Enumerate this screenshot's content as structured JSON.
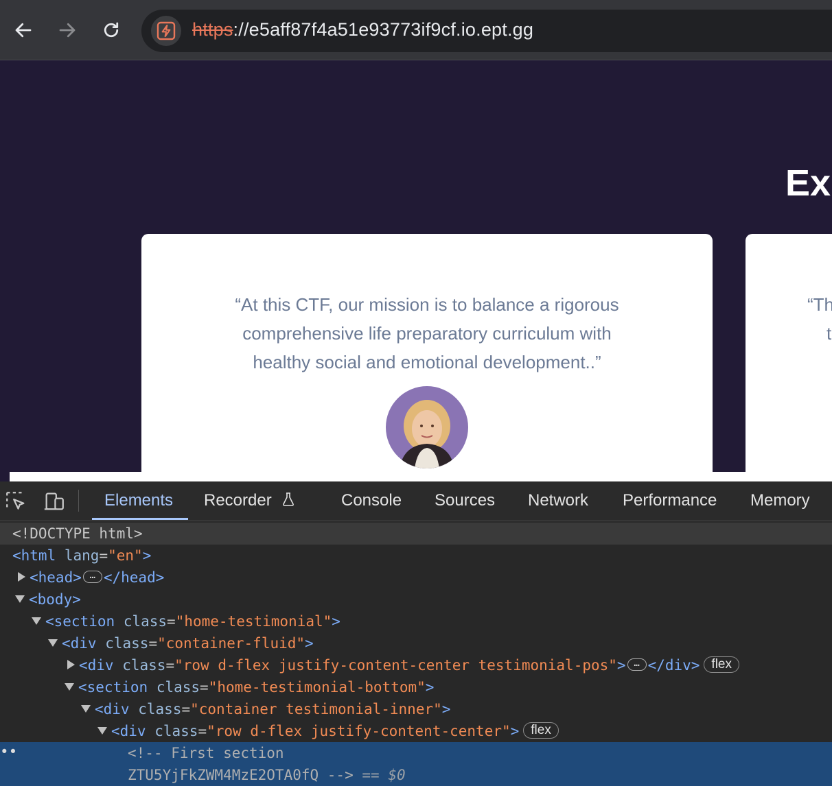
{
  "browser": {
    "url_scheme": "https",
    "url_rest": "://e5aff87f4a51e93773if9cf.io.ept.gg",
    "back_icon": "arrow-left-icon",
    "forward_icon": "arrow-right-icon",
    "reload_icon": "reload-icon",
    "site_icon": "bolt-icon",
    "scheme_color": "#e8775a"
  },
  "page": {
    "heading": "Exp",
    "cards": [
      {
        "quote_lines": [
          "“At this CTF, our mission is to balance a rigorous",
          "comprehensive life preparatory curriculum with",
          "healthy social and emotional development..”"
        ]
      },
      {
        "quote_lines": [
          "“Th",
          "th"
        ]
      }
    ],
    "quote_color": "#6b7a95",
    "background": "#211a35"
  },
  "devtools": {
    "tabs": [
      {
        "label": "Elements",
        "active": true
      },
      {
        "label": "Recorder"
      },
      {
        "label": "Console"
      },
      {
        "label": "Sources"
      },
      {
        "label": "Network"
      },
      {
        "label": "Performance"
      },
      {
        "label": "Memory"
      }
    ],
    "dom": {
      "doctype": "<!DOCTYPE html>",
      "html_tag": "<html",
      "html_attr": "lang",
      "html_val": "\"en\"",
      "head_open": "<head>",
      "head_close": "</head>",
      "body_open": "<body>",
      "section1": {
        "tag": "<section",
        "attr": "class",
        "val": "\"home-testimonial\""
      },
      "div1": {
        "tag": "<div",
        "attr": "class",
        "val": "\"container-fluid\""
      },
      "div2": {
        "tag": "<div",
        "attr": "class",
        "val": "\"row d-flex justify-content-center testimonial-pos\"",
        "close": "</div>",
        "badge": "flex"
      },
      "section2": {
        "tag": "<section",
        "attr": "class",
        "val": "\"home-testimonial-bottom\""
      },
      "div3": {
        "tag": "<div",
        "attr": "class",
        "val": "\"container testimonial-inner\""
      },
      "div4": {
        "tag": "<div",
        "attr": "class",
        "val": "\"row d-flex justify-content-center\"",
        "badge": "flex"
      },
      "comment_line1": "<!-- First section",
      "comment_line2": "ZTU5YjFkZWM4MzE2OTA0fQ -->",
      "selected_marker": "== $0",
      "ellipsis": "…"
    }
  }
}
